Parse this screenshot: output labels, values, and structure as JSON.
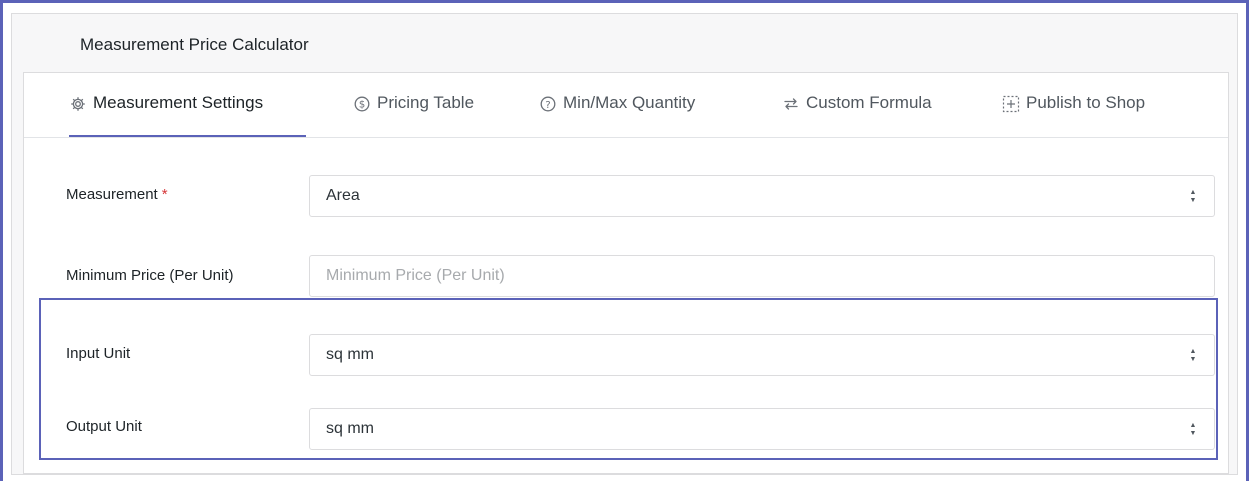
{
  "panel": {
    "title": "Measurement Price Calculator"
  },
  "tabs": [
    {
      "label": "Measurement Settings",
      "icon": "gear-icon",
      "active": true
    },
    {
      "label": "Pricing Table",
      "icon": "dollar-circle-icon",
      "active": false
    },
    {
      "label": "Min/Max Quantity",
      "icon": "question-circle-icon",
      "active": false
    },
    {
      "label": "Custom Formula",
      "icon": "swap-arrows-icon",
      "active": false
    },
    {
      "label": "Publish to Shop",
      "icon": "dashed-plus-box-icon",
      "active": false
    }
  ],
  "form": {
    "measurement": {
      "label": "Measurement",
      "required_mark": "*",
      "value": "Area"
    },
    "minimum_price": {
      "label": "Minimum Price (Per Unit)",
      "placeholder": "Minimum Price (Per Unit)",
      "value": ""
    },
    "input_unit": {
      "label": "Input Unit",
      "value": "sq mm"
    },
    "output_unit": {
      "label": "Output Unit",
      "value": "sq mm"
    }
  },
  "colors": {
    "accent": "#5b62b8",
    "required": "#d63638"
  }
}
